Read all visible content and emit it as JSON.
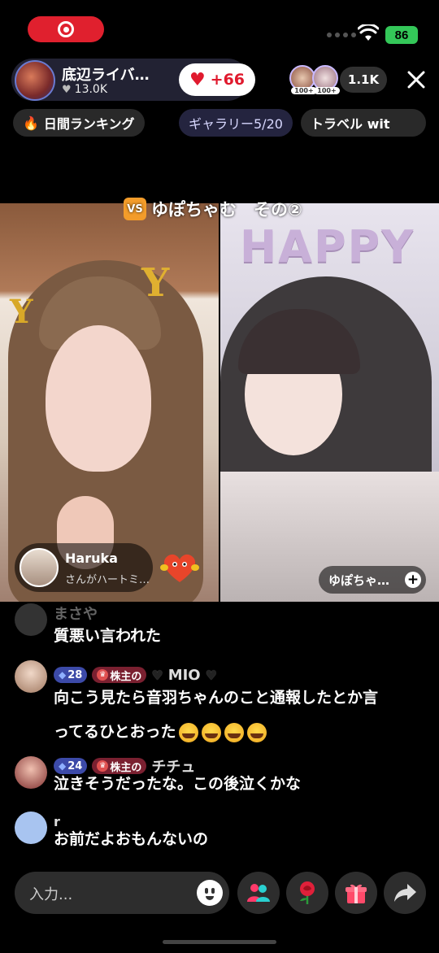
{
  "status": {
    "battery": "86"
  },
  "host": {
    "name": "底辺ライバ…",
    "likes": "13.0K",
    "like_button": "+66"
  },
  "viewers": {
    "badge1": "100+",
    "badge2": "100+",
    "count": "1.1K"
  },
  "chips": {
    "ranking": "日間ランキング",
    "gallery": "ギャラリー5/20",
    "travel": "トラベル wit"
  },
  "battle": {
    "vs_label": "VS",
    "title": "ゆぽちゃむ　その②"
  },
  "left_panel": {
    "balloon_letter": "Y",
    "gifter_name": "Haruka",
    "gifter_action": "さんがハートミ…"
  },
  "right_panel": {
    "balloon_text": "HAPPY",
    "streamer_tag": "ゆぽちゃ…"
  },
  "comments": [
    {
      "user": "まさや",
      "text": "質悪い言われた"
    },
    {
      "level": "28",
      "shareholder": "株主の",
      "user": "MIO",
      "text_line1": "向こう見たら音羽ちゃんのこと通報したとか言",
      "text_line2": "ってるひとおった"
    },
    {
      "level": "24",
      "shareholder": "株主の",
      "user": "チチュ",
      "text": "泣きそうだったな。この後泣くかな"
    },
    {
      "user": "r",
      "text": "お前だよおもんないの"
    }
  ],
  "input": {
    "placeholder": "入力..."
  },
  "colors": {
    "accent_red": "#e0202e",
    "battery_green": "#34c759",
    "vs_orange": "#f39c2a"
  },
  "icons": [
    "record-icon",
    "wifi-icon",
    "close-icon",
    "fire-icon",
    "emoji-icon",
    "collab-icon",
    "rose-icon",
    "gift-icon",
    "share-icon"
  ]
}
